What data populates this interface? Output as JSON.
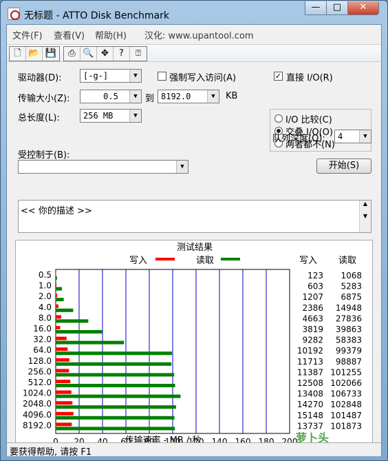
{
  "window": {
    "title": "无标题 - ATTO Disk Benchmark",
    "controls": {
      "minimize": "—",
      "maximize": "□",
      "close": "✕"
    }
  },
  "menu": [
    {
      "label": "文件(F)"
    },
    {
      "label": "查看(V)"
    },
    {
      "label": "帮助(H)"
    },
    {
      "label": "汉化: www.upantool.com"
    }
  ],
  "toolbar": {
    "icons": [
      "new-document-icon",
      "open-folder-icon",
      "save-disk-icon",
      "print-icon",
      "print-preview-icon",
      "move-icon",
      "help-icon",
      "context-help-icon"
    ]
  },
  "settings": {
    "drive_label": "驱动器(D):",
    "drive_value": "[-g-]",
    "transfer_label": "传输大小(Z):",
    "transfer_from": "0.5",
    "to_label": "到",
    "transfer_to": "8192.0",
    "kb_label": "KB",
    "total_label": "总长度(L):",
    "total_value": "256 MB",
    "force_write_label": "强制写入访问(A)",
    "force_write_checked": false,
    "direct_io_label": "直接 I/O(R)",
    "direct_io_checked": true,
    "io_options": [
      {
        "label": "I/O 比较(C)",
        "selected": false
      },
      {
        "label": "交叠 I/O(O)",
        "selected": true
      },
      {
        "label": "两者都不(N)",
        "selected": false
      }
    ],
    "queue_label": "队列深度(Q):",
    "queue_value": "4",
    "controlled_label": "受控制于(B):",
    "controlled_value": "",
    "start_button": "开始(S)",
    "description": "<<  你的描述  >>"
  },
  "results": {
    "title": "测试结果",
    "write_legend": "写入",
    "read_legend": "读取",
    "write_col": "写入",
    "read_col": "读取",
    "colors": {
      "write": "#ff0000",
      "read": "#008000"
    }
  },
  "chart_data": {
    "type": "bar",
    "orientation": "horizontal",
    "title": "测试结果",
    "xlabel": "传输速率 - MB / 秒",
    "xlim": [
      0,
      200
    ],
    "xticks": [
      0,
      20,
      40,
      60,
      80,
      100,
      120,
      140,
      160,
      180,
      200
    ],
    "categories": [
      "0.5",
      "1.0",
      "2.0",
      "4.0",
      "8.0",
      "16.0",
      "32.0",
      "64.0",
      "128.0",
      "256.0",
      "512.0",
      "1024.0",
      "2048.0",
      "4096.0",
      "8192.0"
    ],
    "series": [
      {
        "name": "写入",
        "color": "#ff0000",
        "values": [
          123,
          603,
          1207,
          2386,
          4663,
          3819,
          9282,
          10192,
          11713,
          11387,
          12508,
          13408,
          14270,
          15148,
          13737
        ]
      },
      {
        "name": "读取",
        "color": "#008000",
        "values": [
          1068,
          5283,
          6875,
          14948,
          27836,
          39863,
          58383,
          99379,
          98887,
          101255,
          102066,
          106733,
          102848,
          101487,
          101873
        ]
      }
    ],
    "value_unit_divisor": 1000,
    "grid": true,
    "legend": "top"
  },
  "status": {
    "text": "要获得帮助, 请按 F1"
  },
  "watermark": {
    "text": "萝卜头 IT论坛 www.luobotou.pw"
  }
}
